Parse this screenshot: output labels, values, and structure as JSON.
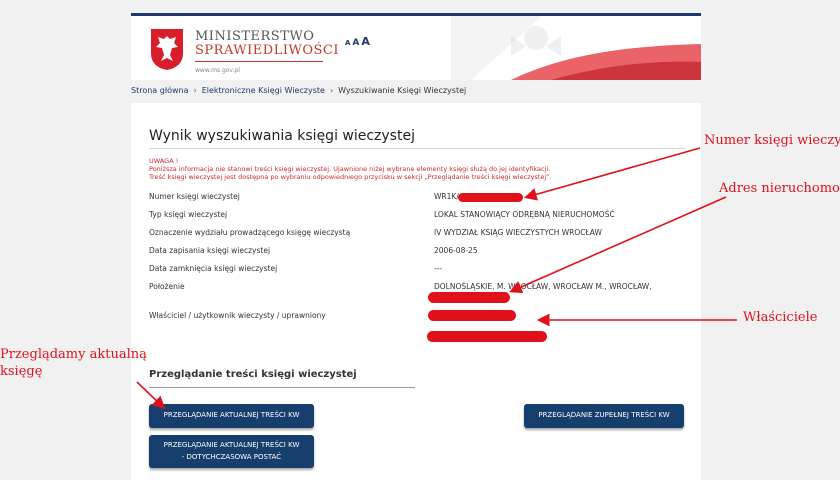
{
  "header": {
    "brand_line1": "MINISTERSTWO",
    "brand_line2": "SPRAWIEDLIWOŚCI",
    "brand_url": "www.ms.gov.pl",
    "font_size_controls": [
      "A",
      "A",
      "A"
    ]
  },
  "breadcrumb": [
    "Strona główna",
    "Elektroniczne Księgi Wieczyste",
    "Wyszukiwanie Księgi Wieczystej"
  ],
  "main": {
    "title": "Wynik wyszukiwania księgi wieczystej",
    "warning": {
      "heading": "UWAGA !",
      "line1": "Poniższa informacja nie stanowi treści księgi wieczystej. Ujawnione niżej wybrane elementy księgi służą do jej identyfikacji.",
      "line2": "Treść księgi wieczystej jest dostępna po wybraniu odpowiedniego przycisku w sekcji „Przeglądanie treści księgi wieczystej”."
    },
    "rows": [
      {
        "label": "Numer księgi wieczystej",
        "value": "WR1K/"
      },
      {
        "label": "Typ księgi wieczystej",
        "value": "LOKAL STANOWIĄCY ODRĘBNĄ NIERUCHOMOŚĆ"
      },
      {
        "label": "Oznaczenie wydziału prowadzącego księgę wieczystą",
        "value": "IV WYDZIAŁ KSIĄG WIECZYSTYCH WROCŁAW"
      },
      {
        "label": "Data zapisania księgi wieczystej",
        "value": "2006-08-25"
      },
      {
        "label": "Data zamknięcia księgi wieczystej",
        "value": "---"
      },
      {
        "label": "Położenie",
        "value": "DOLNOŚLĄSKIE, M. WROCŁAW, WROCŁAW M., WROCŁAW,"
      },
      {
        "label": "Właściciel / użytkownik wieczysty / uprawniony",
        "value": ""
      }
    ],
    "section_title": "Przeglądanie treści księgi wieczystej",
    "buttons": {
      "current": "PRZEGLĄDANIE AKTUALNEJ TREŚCI KW",
      "full": "PRZEGLĄDANIE ZUPEŁNEJ TREŚCI KW",
      "previous_line1": "PRZEGLĄDANIE AKTUALNEJ TREŚCI KW",
      "previous_line2": "- DOTYCHCZASOWA POSTAĆ"
    }
  },
  "annotations": {
    "kw_number": "Numer księgi wieczystej",
    "address": "Adres nieruchomości",
    "owners": "Właściciele",
    "current_line1": "Przeglądamy aktualną",
    "current_line2": "księgę"
  },
  "colors": {
    "navy": "#173f6e",
    "warning_red": "#d0282f",
    "annotation_red": "#e0111a"
  }
}
